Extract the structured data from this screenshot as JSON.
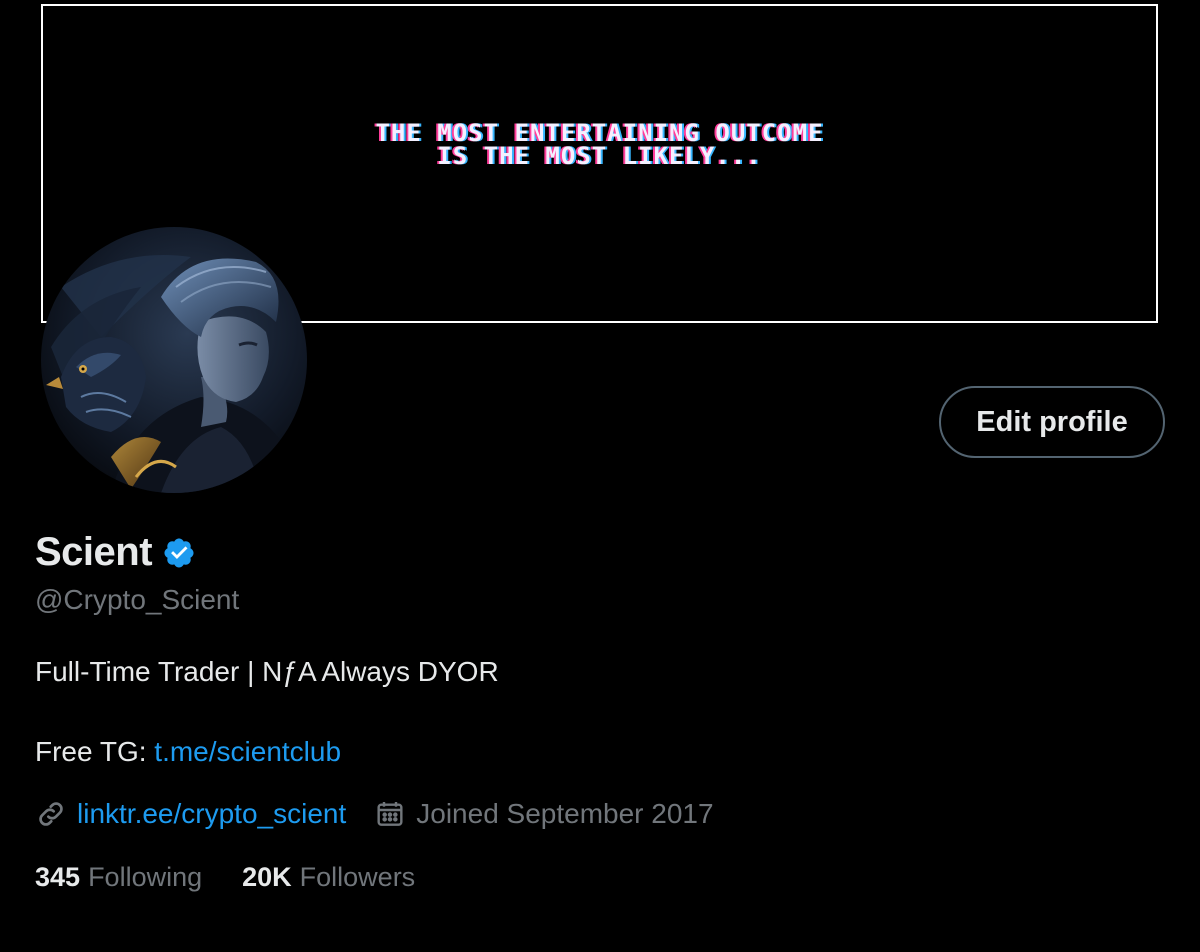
{
  "banner": {
    "text": "THE MOST ENTERTAINING OUTCOME\nIS THE MOST LIKELY..."
  },
  "profile": {
    "display_name": "Scient",
    "verified": true,
    "handle": "@Crypto_Scient",
    "bio_line1": "Full-Time Trader | NƒA Always DYOR",
    "bio_tg_prefix": "Free TG: ",
    "bio_tg_link": "t.me/scientclub",
    "website": "linktr.ee/crypto_scient",
    "joined": "Joined September 2017"
  },
  "actions": {
    "edit_profile_label": "Edit profile"
  },
  "stats": {
    "following_count": "345",
    "following_label": "Following",
    "followers_count": "20K",
    "followers_label": "Followers"
  },
  "icons": {
    "verified": "verified-badge-icon",
    "link": "link-icon",
    "calendar": "calendar-icon"
  },
  "colors": {
    "background": "#000000",
    "primary_text": "#e7e9ea",
    "secondary_text": "#71767b",
    "link": "#1d9bf0",
    "verified_badge": "#1d9bf0",
    "button_border": "#536471"
  }
}
